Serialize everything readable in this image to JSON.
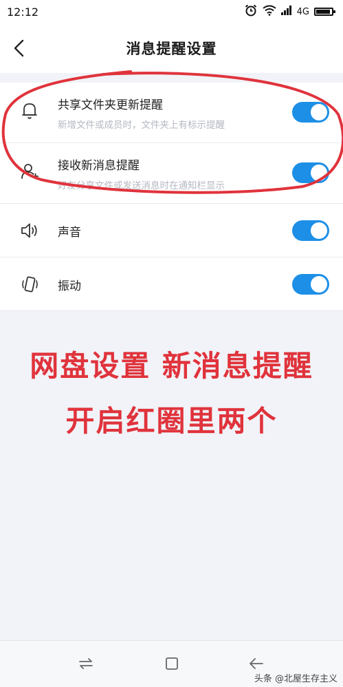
{
  "status_bar": {
    "time": "12:12",
    "network": "4G",
    "icons": [
      "alarm-icon",
      "wifi-icon",
      "signal-icon",
      "battery-icon"
    ]
  },
  "header": {
    "title": "消息提醒设置",
    "back_icon": "chevron-left-icon"
  },
  "settings": {
    "items": [
      {
        "icon": "bell-icon",
        "label": "共享文件夹更新提醒",
        "sublabel": "新增文件或成员时，文件夹上有标示提醒",
        "enabled": true
      },
      {
        "icon": "contact-icon",
        "label": "接收新消息提醒",
        "sublabel": "好友分享文件或发送消息时在通知栏显示",
        "enabled": true
      },
      {
        "icon": "speaker-icon",
        "label": "声音",
        "enabled": true
      },
      {
        "icon": "vibrate-icon",
        "label": "振动",
        "enabled": true
      }
    ]
  },
  "annotation": {
    "line1": "网盘设置 新消息提醒",
    "line2": "开启红圈里两个",
    "color": "#e0333c"
  },
  "nav_bar": {
    "icons": [
      "menu-switch-icon",
      "home-square-icon",
      "back-arrow-icon"
    ]
  },
  "watermark": "头条 @北屋生存主义",
  "colors": {
    "accent": "#1d8fe6",
    "background": "#f1f3f8"
  }
}
